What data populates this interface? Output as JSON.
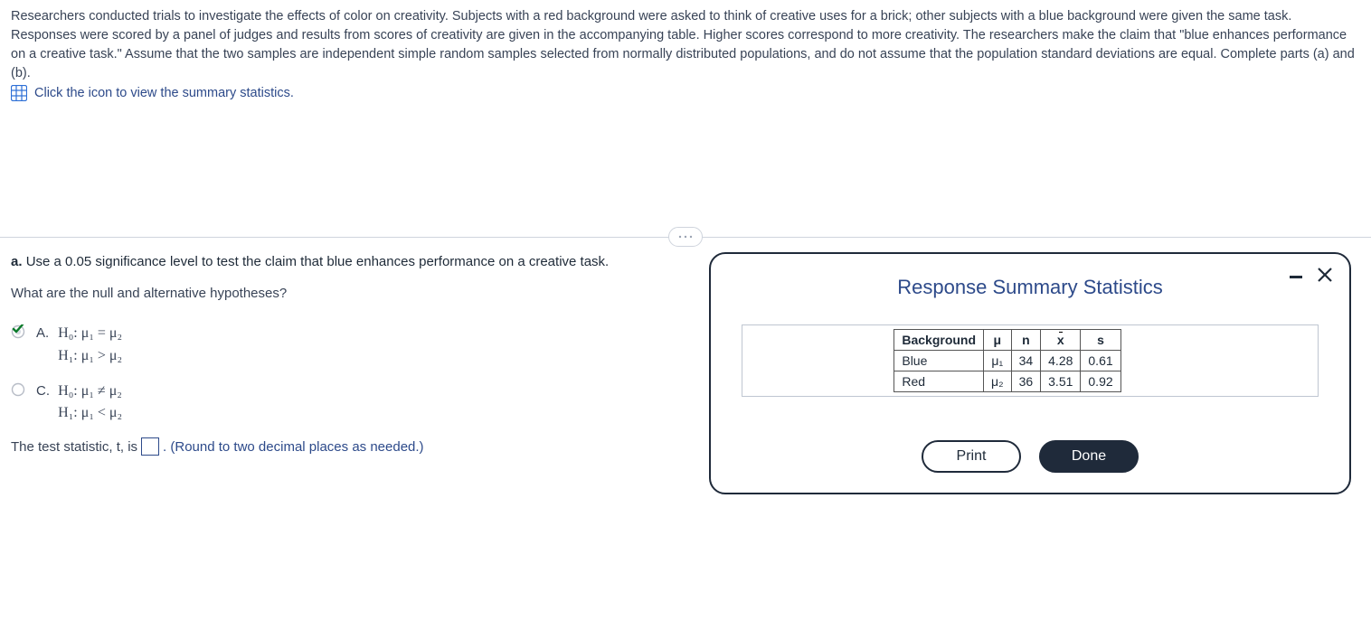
{
  "intro_text": "Researchers conducted trials to investigate the effects of color on creativity. Subjects with a red background were asked to think of creative uses for a brick; other subjects with a blue background were given the same task. Responses were scored by a panel of judges and results from scores of creativity are given in the accompanying table. Higher scores correspond to more creativity. The researchers make the claim that \"blue enhances performance on a creative task.\" Assume that the two samples are independent simple random samples selected from normally distributed populations, and do not assume that the population standard deviations are equal. Complete parts (a) and (b).",
  "icon_link_text": "Click the icon to view the summary statistics.",
  "part_a": {
    "label": "a.",
    "prompt": "Use a 0.05 significance level to test the claim that blue enhances performance on a creative task.",
    "hypotheses_q": "What are the null and alternative hypotheses?"
  },
  "options": {
    "A": {
      "letter": "A.",
      "h0": "H₀: μ₁ = μ₂",
      "h1": "H₁: μ₁ > μ₂",
      "selected": true
    },
    "C": {
      "letter": "C.",
      "h0": "H₀: μ₁ ≠ μ₂",
      "h1": "H₁: μ₁ < μ₂",
      "selected": false
    }
  },
  "test_stat": {
    "prefix": "The test statistic, t, is",
    "hint": ". (Round to two decimal places as needed.)"
  },
  "modal": {
    "title": "Response Summary Statistics",
    "headers": {
      "bg": "Background",
      "mu": "μ",
      "n": "n",
      "xbar": "x",
      "s": "s"
    },
    "rows": [
      {
        "bg": "Blue",
        "mu": "μ₁",
        "n": "34",
        "xbar": "4.28",
        "s": "0.61"
      },
      {
        "bg": "Red",
        "mu": "μ₂",
        "n": "36",
        "xbar": "3.51",
        "s": "0.92"
      }
    ],
    "buttons": {
      "print": "Print",
      "done": "Done"
    }
  },
  "chart_data": {
    "type": "table",
    "title": "Response Summary Statistics",
    "columns": [
      "Background",
      "μ",
      "n",
      "x̄",
      "s"
    ],
    "rows": [
      [
        "Blue",
        "μ₁",
        34,
        4.28,
        0.61
      ],
      [
        "Red",
        "μ₂",
        36,
        3.51,
        0.92
      ]
    ]
  }
}
